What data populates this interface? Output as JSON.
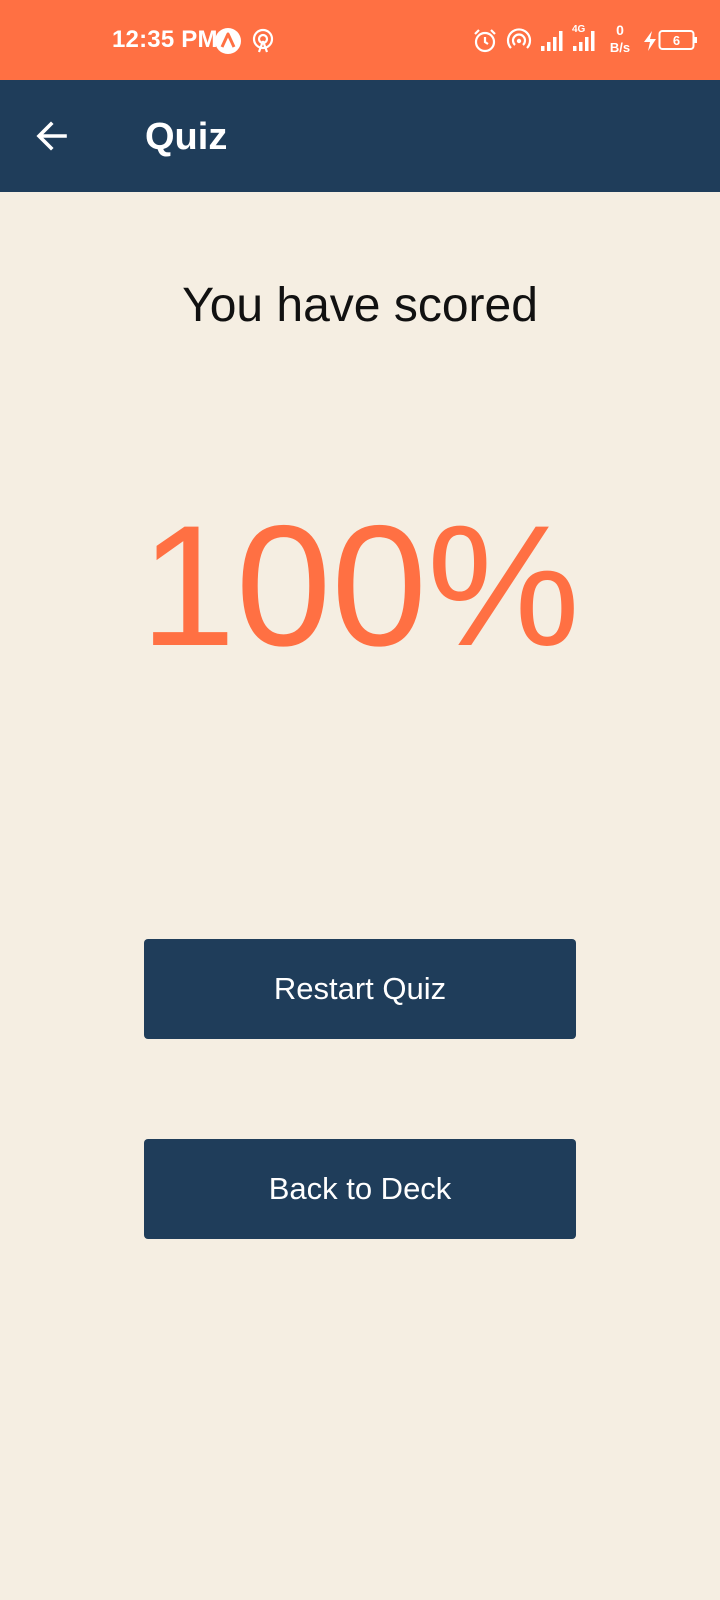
{
  "status_bar": {
    "time": "12:35 PM",
    "network_type": "4G",
    "speed_value": "0",
    "speed_unit": "B/s",
    "battery_level": "6",
    "icons": [
      "app-notification-icon",
      "hotspot-icon",
      "alarm-icon",
      "wifi-hotspot-icon",
      "signal-icon",
      "signal-4g-icon",
      "charging-icon",
      "battery-icon"
    ],
    "background_color": "#ff7043"
  },
  "app_bar": {
    "title": "Quiz",
    "back_icon": "arrow-left-icon",
    "background_color": "#1f3d5a"
  },
  "result": {
    "label": "You have scored",
    "score": "100%",
    "score_color": "#ff7043"
  },
  "actions": {
    "restart_label": "Restart Quiz",
    "back_label": "Back to Deck"
  },
  "colors": {
    "page_background": "#f5eee2",
    "button_background": "#1f3d5a"
  }
}
